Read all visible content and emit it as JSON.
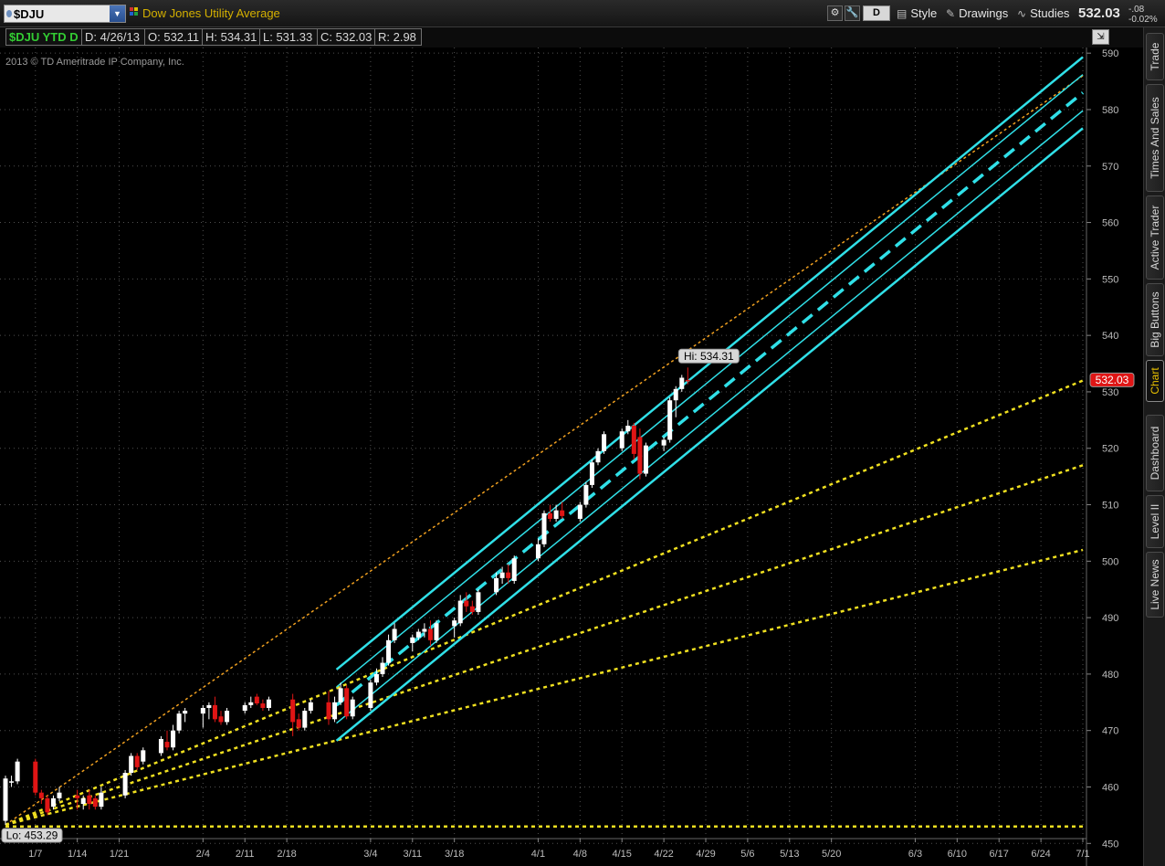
{
  "header": {
    "symbol": "$DJU",
    "symbol_name": "Dow Jones Utility Average",
    "aggregation_button": "D",
    "menus": {
      "style": "Style",
      "drawings": "Drawings",
      "studies": "Studies"
    },
    "last_price": "532.03",
    "net_change": "-.08",
    "percent_change": "-0.02%",
    "icons": [
      "settings-icon",
      "wrench-icon",
      "style-icon",
      "drawings-icon",
      "studies-icon"
    ]
  },
  "infobar": {
    "ticker": "$DJU YTD D",
    "date": "D: 4/26/13",
    "open": "O: 532.11",
    "high": "H: 534.31",
    "low": "L: 531.33",
    "close": "C: 532.03",
    "range": "R: 2.98"
  },
  "chart": {
    "copyright": "2013 © TD Ameritrade IP Company, Inc.",
    "hi_label": "Hi: 534.31",
    "lo_label": "Lo: 453.29",
    "price_bubble": "532.03",
    "colors": {
      "bull": "#ffffff",
      "bear": "#e01515",
      "channel": "#30e0e8",
      "fan": "#f0e020",
      "grid": "#505050"
    }
  },
  "sidebar": {
    "tabs": [
      "Trade",
      "Times And Sales",
      "Active Trader",
      "Big Buttons",
      "Chart",
      "Dashboard",
      "Level II",
      "Live News"
    ],
    "active": "Chart"
  },
  "chart_data": {
    "type": "candlestick",
    "title": "Dow Jones Utility Average",
    "xlabel": "",
    "ylabel": "",
    "ylim": [
      446,
      591
    ],
    "yticks": [
      450,
      460,
      470,
      480,
      490,
      500,
      510,
      520,
      530,
      540,
      550,
      560,
      570,
      580,
      590
    ],
    "x_tick_labels": [
      "1/7",
      "1/14",
      "1/21",
      "2/4",
      "2/11",
      "2/18",
      "3/4",
      "3/11",
      "3/18",
      "4/1",
      "4/8",
      "4/15",
      "4/22",
      "4/29",
      "5/6",
      "5/13",
      "5/20",
      "6/3",
      "6/10",
      "6/17",
      "6/24",
      "7/1"
    ],
    "grid": true,
    "price_axis_side": "right",
    "candles": [
      {
        "date": "1/2",
        "o": 454,
        "h": 462,
        "l": 453.29,
        "c": 461.5
      },
      {
        "date": "1/3",
        "o": 461,
        "h": 462,
        "l": 460,
        "c": 461
      },
      {
        "date": "1/4",
        "o": 461,
        "h": 465,
        "l": 460.5,
        "c": 464.5
      },
      {
        "date": "1/7",
        "o": 464.5,
        "h": 465,
        "l": 458.5,
        "c": 459
      },
      {
        "date": "1/8",
        "o": 459,
        "h": 459.5,
        "l": 457,
        "c": 458
      },
      {
        "date": "1/9",
        "o": 458,
        "h": 458.5,
        "l": 455,
        "c": 455.5
      },
      {
        "date": "1/10",
        "o": 456.5,
        "h": 458.5,
        "l": 456,
        "c": 458
      },
      {
        "date": "1/11",
        "o": 458,
        "h": 460,
        "l": 457.5,
        "c": 459
      },
      {
        "date": "1/14",
        "o": 458.5,
        "h": 459.5,
        "l": 456,
        "c": 458
      },
      {
        "date": "1/15",
        "o": 457,
        "h": 458.5,
        "l": 456,
        "c": 458
      },
      {
        "date": "1/16",
        "o": 458.5,
        "h": 459.5,
        "l": 456,
        "c": 457
      },
      {
        "date": "1/17",
        "o": 458,
        "h": 458.5,
        "l": 456,
        "c": 456.5
      },
      {
        "date": "1/18",
        "o": 456.5,
        "h": 460,
        "l": 456,
        "c": 459
      },
      {
        "date": "1/22",
        "o": 458.5,
        "h": 463,
        "l": 458,
        "c": 462.5
      },
      {
        "date": "1/23",
        "o": 462.5,
        "h": 466,
        "l": 462,
        "c": 465.5
      },
      {
        "date": "1/24",
        "o": 465.5,
        "h": 466,
        "l": 463,
        "c": 463.5
      },
      {
        "date": "1/25",
        "o": 464.5,
        "h": 467,
        "l": 464,
        "c": 466.5
      },
      {
        "date": "1/28",
        "o": 466,
        "h": 469,
        "l": 465.5,
        "c": 468.5
      },
      {
        "date": "1/29",
        "o": 468,
        "h": 470,
        "l": 466.5,
        "c": 467
      },
      {
        "date": "1/30",
        "o": 467,
        "h": 471,
        "l": 466.5,
        "c": 470
      },
      {
        "date": "1/31",
        "o": 470,
        "h": 473.5,
        "l": 469.5,
        "c": 473
      },
      {
        "date": "2/1",
        "o": 473,
        "h": 474,
        "l": 471.5,
        "c": 473.5
      },
      {
        "date": "2/4",
        "o": 473,
        "h": 474.5,
        "l": 470.5,
        "c": 474
      },
      {
        "date": "2/5",
        "o": 474,
        "h": 475,
        "l": 472,
        "c": 474.5
      },
      {
        "date": "2/6",
        "o": 474.5,
        "h": 476,
        "l": 471.5,
        "c": 472
      },
      {
        "date": "2/7",
        "o": 472.5,
        "h": 473.5,
        "l": 471,
        "c": 471.5
      },
      {
        "date": "2/8",
        "o": 471.5,
        "h": 474,
        "l": 471,
        "c": 473.5
      },
      {
        "date": "2/11",
        "o": 473.5,
        "h": 475,
        "l": 473,
        "c": 474.5
      },
      {
        "date": "2/12",
        "o": 474.5,
        "h": 476,
        "l": 474,
        "c": 475
      },
      {
        "date": "2/13",
        "o": 476,
        "h": 476.5,
        "l": 474.5,
        "c": 474.8
      },
      {
        "date": "2/14",
        "o": 474.8,
        "h": 475.5,
        "l": 473.5,
        "c": 474
      },
      {
        "date": "2/15",
        "o": 474,
        "h": 476,
        "l": 473.5,
        "c": 475.5
      },
      {
        "date": "2/19",
        "o": 475.5,
        "h": 476.5,
        "l": 469,
        "c": 471.5
      },
      {
        "date": "2/20",
        "o": 472,
        "h": 473,
        "l": 470,
        "c": 470.5
      },
      {
        "date": "2/21",
        "o": 470.5,
        "h": 474,
        "l": 470,
        "c": 473.5
      },
      {
        "date": "2/22",
        "o": 473.5,
        "h": 475.5,
        "l": 473,
        "c": 475
      },
      {
        "date": "2/25",
        "o": 475,
        "h": 477,
        "l": 471,
        "c": 472
      },
      {
        "date": "2/26",
        "o": 472,
        "h": 476,
        "l": 471.5,
        "c": 475
      },
      {
        "date": "2/27",
        "o": 475,
        "h": 478.5,
        "l": 474.5,
        "c": 477.5
      },
      {
        "date": "2/28",
        "o": 477.5,
        "h": 478,
        "l": 472,
        "c": 472.5
      },
      {
        "date": "3/1",
        "o": 472.5,
        "h": 476,
        "l": 472,
        "c": 475.5
      },
      {
        "date": "3/4",
        "o": 474,
        "h": 479,
        "l": 473.5,
        "c": 478.5
      },
      {
        "date": "3/5",
        "o": 478.5,
        "h": 481,
        "l": 478,
        "c": 480
      },
      {
        "date": "3/6",
        "o": 480,
        "h": 483,
        "l": 479.5,
        "c": 482
      },
      {
        "date": "3/7",
        "o": 482,
        "h": 487,
        "l": 481.5,
        "c": 486
      },
      {
        "date": "3/8",
        "o": 486,
        "h": 489,
        "l": 485.5,
        "c": 488
      },
      {
        "date": "3/11",
        "o": 485.5,
        "h": 487,
        "l": 484,
        "c": 486.5
      },
      {
        "date": "3/12",
        "o": 486.5,
        "h": 488,
        "l": 486,
        "c": 487.5
      },
      {
        "date": "3/13",
        "o": 487.5,
        "h": 489,
        "l": 486.5,
        "c": 488
      },
      {
        "date": "3/14",
        "o": 488,
        "h": 489.5,
        "l": 485,
        "c": 486
      },
      {
        "date": "3/15",
        "o": 486,
        "h": 489.5,
        "l": 485.5,
        "c": 489
      },
      {
        "date": "3/18",
        "o": 488.5,
        "h": 490,
        "l": 486.5,
        "c": 489.5
      },
      {
        "date": "3/19",
        "o": 489,
        "h": 494,
        "l": 488.5,
        "c": 493
      },
      {
        "date": "3/20",
        "o": 493,
        "h": 494.5,
        "l": 491,
        "c": 492
      },
      {
        "date": "3/21",
        "o": 492,
        "h": 493,
        "l": 490.5,
        "c": 491
      },
      {
        "date": "3/22",
        "o": 491,
        "h": 495,
        "l": 490.5,
        "c": 494.5
      },
      {
        "date": "3/25",
        "o": 494.5,
        "h": 498,
        "l": 494,
        "c": 497
      },
      {
        "date": "3/26",
        "o": 497,
        "h": 499,
        "l": 496,
        "c": 498
      },
      {
        "date": "3/27",
        "o": 498,
        "h": 499.5,
        "l": 496,
        "c": 497
      },
      {
        "date": "3/28",
        "o": 496.5,
        "h": 501,
        "l": 496,
        "c": 500.5
      },
      {
        "date": "4/1",
        "o": 500.5,
        "h": 504,
        "l": 500,
        "c": 503
      },
      {
        "date": "4/2",
        "o": 503,
        "h": 509,
        "l": 502.5,
        "c": 508.5
      },
      {
        "date": "4/3",
        "o": 508.5,
        "h": 510,
        "l": 507,
        "c": 507.5
      },
      {
        "date": "4/4",
        "o": 507.5,
        "h": 510,
        "l": 507,
        "c": 509
      },
      {
        "date": "4/5",
        "o": 509,
        "h": 510.5,
        "l": 507.5,
        "c": 508
      },
      {
        "date": "4/8",
        "o": 507.5,
        "h": 510.5,
        "l": 507,
        "c": 510
      },
      {
        "date": "4/9",
        "o": 510,
        "h": 514,
        "l": 509.5,
        "c": 513.5
      },
      {
        "date": "4/10",
        "o": 513.5,
        "h": 518,
        "l": 513,
        "c": 517.5
      },
      {
        "date": "4/11",
        "o": 517.5,
        "h": 520,
        "l": 517,
        "c": 519.5
      },
      {
        "date": "4/12",
        "o": 519.5,
        "h": 523,
        "l": 519,
        "c": 522.5
      },
      {
        "date": "4/15",
        "o": 520,
        "h": 523.5,
        "l": 519.5,
        "c": 523
      },
      {
        "date": "4/16",
        "o": 523,
        "h": 525,
        "l": 522.5,
        "c": 524
      },
      {
        "date": "4/17",
        "o": 524,
        "h": 524.5,
        "l": 518,
        "c": 519
      },
      {
        "date": "4/18",
        "o": 522,
        "h": 523.5,
        "l": 514.5,
        "c": 515.5
      },
      {
        "date": "4/19",
        "o": 515.5,
        "h": 521,
        "l": 515,
        "c": 520.5
      },
      {
        "date": "4/22",
        "o": 520.5,
        "h": 522,
        "l": 519.5,
        "c": 521.5
      },
      {
        "date": "4/23",
        "o": 521.5,
        "h": 529,
        "l": 521,
        "c": 528.5
      },
      {
        "date": "4/24",
        "o": 528.5,
        "h": 531,
        "l": 525.5,
        "c": 530.5
      },
      {
        "date": "4/25",
        "o": 530.5,
        "h": 533,
        "l": 530,
        "c": 532.5
      },
      {
        "date": "4/26",
        "o": 532.11,
        "h": 534.31,
        "l": 531.33,
        "c": 532.03
      }
    ],
    "regression_channel": {
      "from": "2/26",
      "to": "7/1",
      "mid_start": 474.5,
      "mid_end": 583,
      "inner_offset": 3.2,
      "outer_offset": 6.3
    },
    "speed_fan": {
      "origin": {
        "date": "1/2",
        "price": 453.29
      },
      "end_prices_7_1": [
        586,
        532,
        517,
        502
      ],
      "horizontal": 453
    }
  }
}
